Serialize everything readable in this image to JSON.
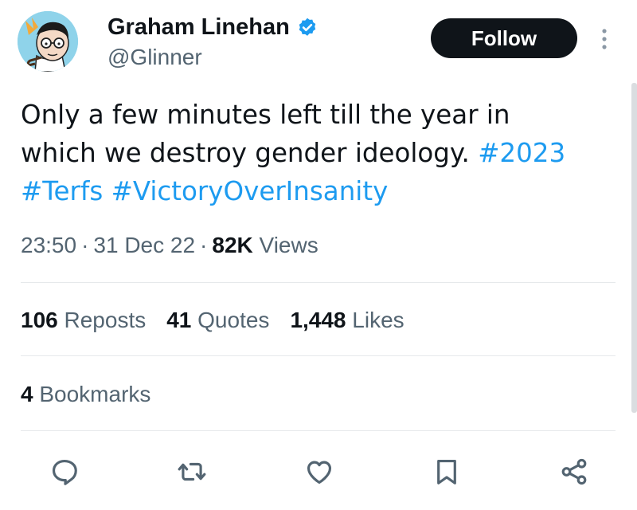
{
  "author": {
    "display_name": "Graham Linehan",
    "handle": "@Glinner",
    "verified": true,
    "avatar_icon": "cartoon-portrait-avatar"
  },
  "follow_label": "Follow",
  "tweet": {
    "line1": "Only a few minutes left till  the year in",
    "line2_text": "which we destroy gender ideology. ",
    "line2_tag": "#2023",
    "tag1": "#Terfs",
    "tag2": "#VictoryOverInsanity"
  },
  "meta": {
    "time": "23:50",
    "date": "31 Dec 22",
    "views_count": "82K",
    "views_label": "Views"
  },
  "stats": {
    "reposts_count": "106",
    "reposts_label": "Reposts",
    "quotes_count": "41",
    "quotes_label": "Quotes",
    "likes_count": "1,448",
    "likes_label": "Likes",
    "bookmarks_count": "4",
    "bookmarks_label": "Bookmarks"
  },
  "actions": [
    "reply-icon",
    "repost-icon",
    "like-icon",
    "bookmark-icon",
    "share-icon"
  ],
  "colors": {
    "text": "#0f1419",
    "secondary": "#536471",
    "link": "#1d9bf0",
    "verified": "#1d9bf0",
    "button_bg": "#0f1419"
  }
}
